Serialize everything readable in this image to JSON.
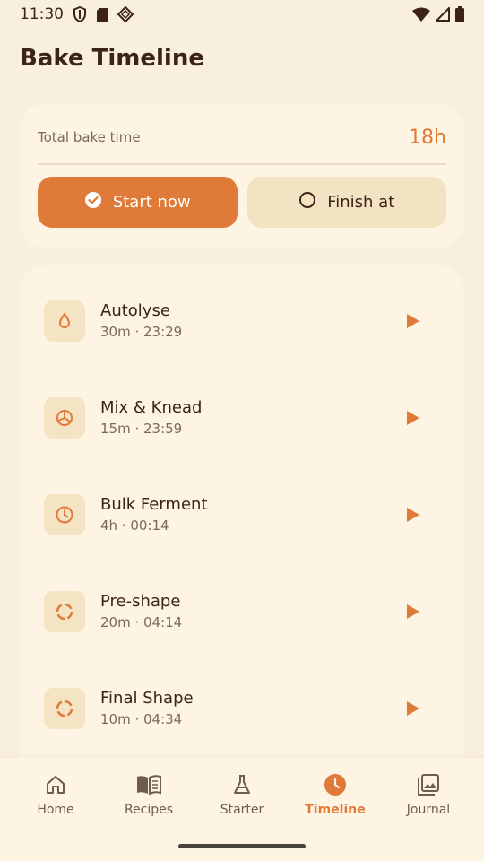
{
  "status_bar": {
    "time": "11:30",
    "left_icons": [
      "shield-icon",
      "sd-card-icon",
      "diamond-icon"
    ],
    "right_icons": [
      "wifi-icon",
      "signal-icon",
      "battery-icon"
    ]
  },
  "page": {
    "title": "Bake Timeline"
  },
  "summary": {
    "total_label": "Total bake time",
    "total_value": "18h",
    "start_now_label": "Start now",
    "finish_at_label": "Finish at"
  },
  "steps": [
    {
      "name": "Autolyse",
      "meta": "30m · 23:29",
      "icon": "water-drop-icon"
    },
    {
      "name": "Mix & Knead",
      "meta": "15m · 23:59",
      "icon": "mix-icon"
    },
    {
      "name": "Bulk Ferment",
      "meta": "4h · 00:14",
      "icon": "clock-icon"
    },
    {
      "name": "Pre-shape",
      "meta": "20m · 04:14",
      "icon": "shape-icon"
    },
    {
      "name": "Final Shape",
      "meta": "10m · 04:34",
      "icon": "shape-icon"
    }
  ],
  "nav": {
    "items": [
      {
        "label": "Home",
        "icon": "home-icon"
      },
      {
        "label": "Recipes",
        "icon": "book-icon"
      },
      {
        "label": "Starter",
        "icon": "flask-icon"
      },
      {
        "label": "Timeline",
        "icon": "timeline-clock-icon"
      },
      {
        "label": "Journal",
        "icon": "photo-journal-icon"
      }
    ],
    "active": "Timeline"
  },
  "colors": {
    "background": "#f9efe1",
    "card": "#fdf4e3",
    "accent": "#e07a38",
    "secondary_button": "#f3e3c2",
    "icon_tile": "#f5e4c4",
    "text_primary": "#3b2417",
    "text_secondary": "#7a6a5b"
  }
}
